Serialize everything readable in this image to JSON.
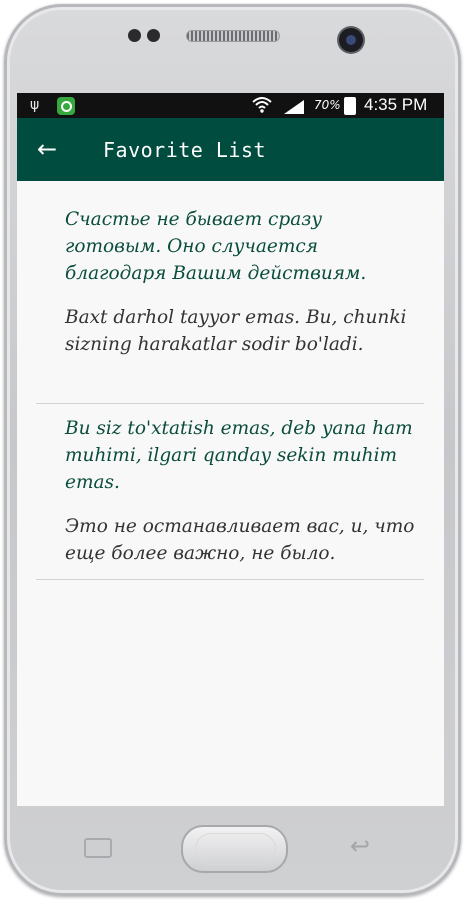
{
  "status_bar": {
    "usb_icon": "usb-icon",
    "app_icon": "app-notification-icon",
    "wifi_icon": "wifi-icon",
    "signal_icon": "signal-icon",
    "battery_percent": "70%",
    "battery_icon": "battery-charging-icon",
    "time": "4:35 PM"
  },
  "toolbar": {
    "back_icon": "arrow-left-icon",
    "title": "Favorite List",
    "background_color": "#004d40"
  },
  "favorites": [
    {
      "source": "Счастье не бывает сразу готовым. Оно случается благодаря Вашим действиям.",
      "translation": "Baxt darhol tayyor emas. Bu, chunki sizning harakatlar sodir bo'ladi."
    },
    {
      "source": "Bu siz to'xtatish emas, deb yana ham muhimi, ilgari qanday sekin muhim emas.",
      "translation": "Это не останавливает вас, и, что еще более важно, не было."
    }
  ],
  "colors": {
    "source_text": "#0b4d3d",
    "translation_text": "#333333"
  },
  "device": {
    "recents_icon": "recents-icon",
    "home_button": "home-button",
    "back_key_icon": "back-key-icon"
  }
}
